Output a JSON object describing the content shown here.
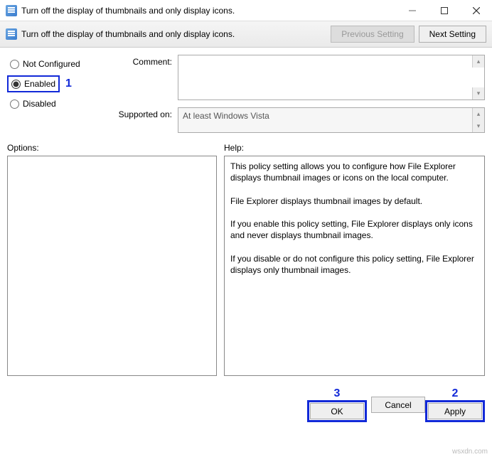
{
  "window": {
    "title": "Turn off the display of thumbnails and only display icons."
  },
  "toolbar": {
    "title": "Turn off the display of thumbnails and only display icons.",
    "prev": "Previous Setting",
    "next": "Next Setting"
  },
  "radios": {
    "not_configured": "Not Configured",
    "enabled": "Enabled",
    "disabled": "Disabled",
    "selected": "enabled"
  },
  "markers": {
    "m1": "1",
    "m2": "2",
    "m3": "3"
  },
  "meta": {
    "comment_label": "Comment:",
    "comment_value": "",
    "supported_label": "Supported on:",
    "supported_value": "At least Windows Vista"
  },
  "labels": {
    "options": "Options:",
    "help": "Help:"
  },
  "help_text": "This policy setting allows you to configure how File Explorer displays thumbnail images or icons on the local computer.\n\nFile Explorer displays thumbnail images by default.\n\nIf you enable this policy setting, File Explorer displays only icons and never displays thumbnail images.\n\nIf you disable or do not configure this policy setting, File Explorer displays only thumbnail images.",
  "buttons": {
    "ok": "OK",
    "cancel": "Cancel",
    "apply": "Apply"
  },
  "watermark": "wsxdn.com"
}
